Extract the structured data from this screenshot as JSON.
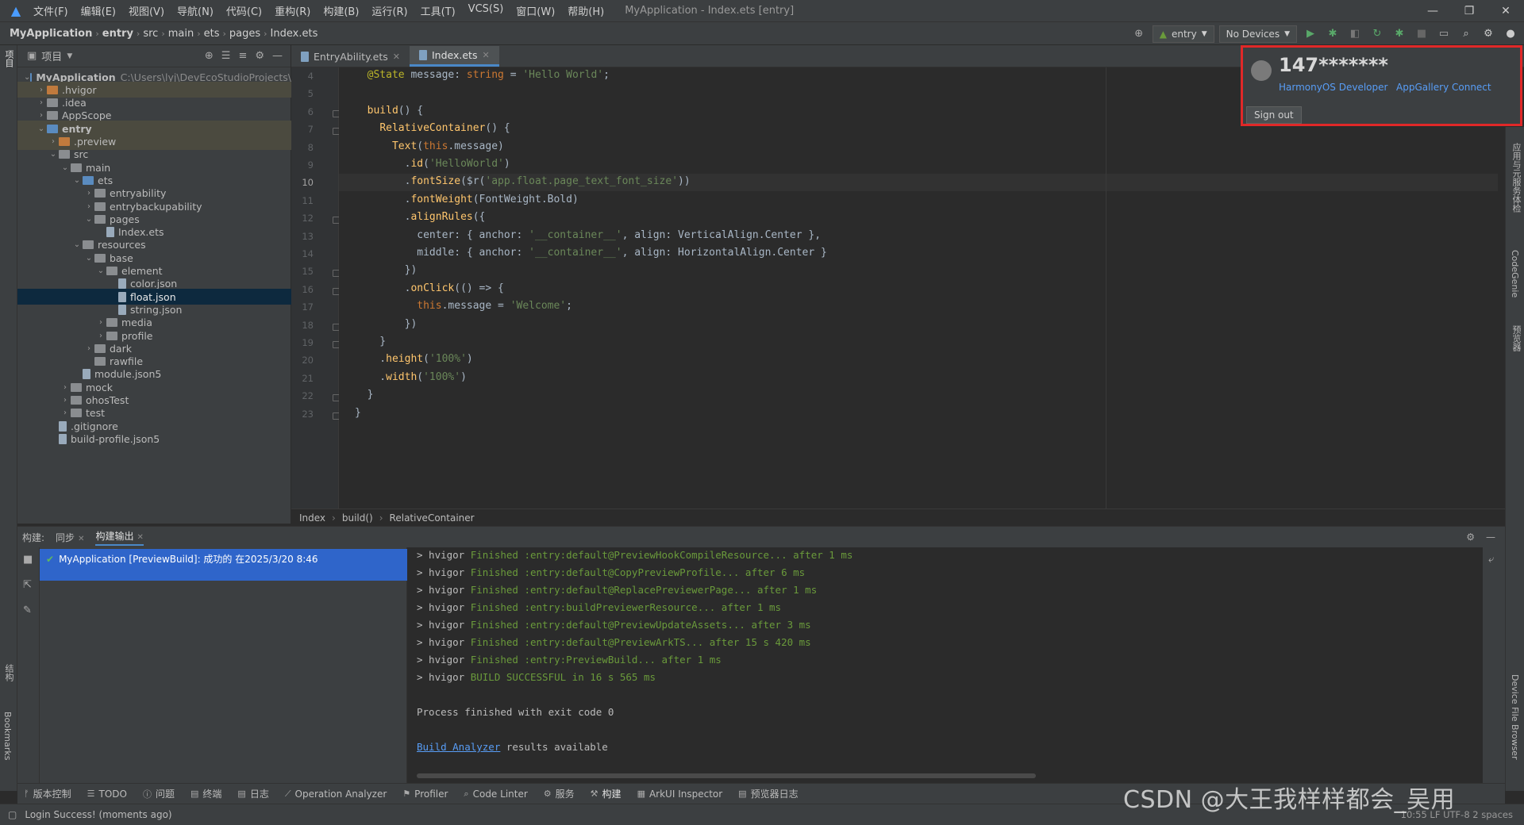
{
  "menubar": {
    "items": [
      "文件(F)",
      "编辑(E)",
      "视图(V)",
      "导航(N)",
      "代码(C)",
      "重构(R)",
      "构建(B)",
      "运行(R)",
      "工具(T)",
      "VCS(S)",
      "窗口(W)",
      "帮助(H)"
    ],
    "window_title": "MyApplication - Index.ets [entry]"
  },
  "navbar": {
    "crumbs": [
      "MyApplication",
      "entry",
      "src",
      "main",
      "ets",
      "pages",
      "Index.ets"
    ],
    "module_combo": "entry",
    "device_combo": "No Devices"
  },
  "project_panel": {
    "title": "项目",
    "tree": [
      {
        "label": "MyApplication",
        "path": "C:\\Users\\lyj\\DevEcoStudioProjects\\",
        "depth": 0,
        "chev": "v",
        "icon": "folder-blue",
        "bold": true
      },
      {
        "label": ".hvigor",
        "depth": 1,
        "chev": ">",
        "icon": "folder-orange",
        "highlight": true
      },
      {
        "label": ".idea",
        "depth": 1,
        "chev": ">",
        "icon": "folder"
      },
      {
        "label": "AppScope",
        "depth": 1,
        "chev": ">",
        "icon": "folder"
      },
      {
        "label": "entry",
        "depth": 1,
        "chev": "v",
        "icon": "folder-blue",
        "bold": true,
        "highlight": true
      },
      {
        "label": ".preview",
        "depth": 2,
        "chev": ">",
        "icon": "folder-orange",
        "highlight": true
      },
      {
        "label": "src",
        "depth": 2,
        "chev": "v",
        "icon": "folder"
      },
      {
        "label": "main",
        "depth": 3,
        "chev": "v",
        "icon": "folder"
      },
      {
        "label": "ets",
        "depth": 4,
        "chev": "v",
        "icon": "folder-blue"
      },
      {
        "label": "entryability",
        "depth": 5,
        "chev": ">",
        "icon": "folder"
      },
      {
        "label": "entrybackupability",
        "depth": 5,
        "chev": ">",
        "icon": "folder"
      },
      {
        "label": "pages",
        "depth": 5,
        "chev": "v",
        "icon": "folder"
      },
      {
        "label": "Index.ets",
        "depth": 6,
        "chev": "",
        "icon": "file"
      },
      {
        "label": "resources",
        "depth": 4,
        "chev": "v",
        "icon": "folder"
      },
      {
        "label": "base",
        "depth": 5,
        "chev": "v",
        "icon": "folder"
      },
      {
        "label": "element",
        "depth": 6,
        "chev": "v",
        "icon": "folder"
      },
      {
        "label": "color.json",
        "depth": 7,
        "chev": "",
        "icon": "file"
      },
      {
        "label": "float.json",
        "depth": 7,
        "chev": "",
        "icon": "file",
        "selected": true
      },
      {
        "label": "string.json",
        "depth": 7,
        "chev": "",
        "icon": "file"
      },
      {
        "label": "media",
        "depth": 6,
        "chev": ">",
        "icon": "folder"
      },
      {
        "label": "profile",
        "depth": 6,
        "chev": ">",
        "icon": "folder"
      },
      {
        "label": "dark",
        "depth": 5,
        "chev": ">",
        "icon": "folder"
      },
      {
        "label": "rawfile",
        "depth": 5,
        "chev": "",
        "icon": "folder"
      },
      {
        "label": "module.json5",
        "depth": 4,
        "chev": "",
        "icon": "file"
      },
      {
        "label": "mock",
        "depth": 3,
        "chev": ">",
        "icon": "folder"
      },
      {
        "label": "ohosTest",
        "depth": 3,
        "chev": ">",
        "icon": "folder"
      },
      {
        "label": "test",
        "depth": 3,
        "chev": ">",
        "icon": "folder"
      },
      {
        "label": ".gitignore",
        "depth": 2,
        "chev": "",
        "icon": "file"
      },
      {
        "label": "build-profile.json5",
        "depth": 2,
        "chev": "",
        "icon": "file"
      }
    ]
  },
  "editor": {
    "tabs": [
      {
        "label": "EntryAbility.ets",
        "active": false
      },
      {
        "label": "Index.ets",
        "active": true
      }
    ],
    "current_line": 10,
    "line_numbers": [
      4,
      5,
      6,
      7,
      8,
      9,
      10,
      11,
      12,
      13,
      14,
      15,
      16,
      17,
      18,
      19,
      20,
      21,
      22,
      23
    ],
    "lines": [
      [
        [
          "  ",
          "pl"
        ],
        [
          "@State",
          "dec"
        ],
        [
          " message: ",
          "pl"
        ],
        [
          "string",
          "ty"
        ],
        [
          " = ",
          "pl"
        ],
        [
          "'Hello World'",
          "str"
        ],
        [
          ";",
          "pl"
        ]
      ],
      [],
      [
        [
          "  ",
          "pl"
        ],
        [
          "build",
          "fn"
        ],
        [
          "() {",
          "pl"
        ]
      ],
      [
        [
          "    ",
          "pl"
        ],
        [
          "RelativeContainer",
          "fn"
        ],
        [
          "() {",
          "pl"
        ]
      ],
      [
        [
          "      ",
          "pl"
        ],
        [
          "Text",
          "fn"
        ],
        [
          "(",
          "pl"
        ],
        [
          "this",
          "this"
        ],
        [
          ".message)",
          "pl"
        ]
      ],
      [
        [
          "        .",
          "pl"
        ],
        [
          "id",
          "fn"
        ],
        [
          "(",
          "pl"
        ],
        [
          "'HelloWorld'",
          "str"
        ],
        [
          ")",
          "pl"
        ]
      ],
      [
        [
          "        .",
          "pl"
        ],
        [
          "fontSize",
          "fn"
        ],
        [
          "($r(",
          "pl"
        ],
        [
          "'app.float.page_text_font_size'",
          "str"
        ],
        [
          "))",
          "pl"
        ]
      ],
      [
        [
          "        .",
          "pl"
        ],
        [
          "fontWeight",
          "fn"
        ],
        [
          "(FontWeight.Bold)",
          "pl"
        ]
      ],
      [
        [
          "        .",
          "pl"
        ],
        [
          "alignRules",
          "fn"
        ],
        [
          "({",
          "pl"
        ]
      ],
      [
        [
          "          center: { anchor: ",
          "pl"
        ],
        [
          "'__container__'",
          "str"
        ],
        [
          ", align: VerticalAlign.Center },",
          "pl"
        ]
      ],
      [
        [
          "          middle: { anchor: ",
          "pl"
        ],
        [
          "'__container__'",
          "str"
        ],
        [
          ", align: HorizontalAlign.Center }",
          "pl"
        ]
      ],
      [
        [
          "        })",
          "pl"
        ]
      ],
      [
        [
          "        .",
          "pl"
        ],
        [
          "onClick",
          "fn"
        ],
        [
          "(() => {",
          "pl"
        ]
      ],
      [
        [
          "          ",
          "pl"
        ],
        [
          "this",
          "this"
        ],
        [
          ".message = ",
          "pl"
        ],
        [
          "'Welcome'",
          "str"
        ],
        [
          ";",
          "pl"
        ]
      ],
      [
        [
          "        })",
          "pl"
        ]
      ],
      [
        [
          "    }",
          "pl"
        ]
      ],
      [
        [
          "    .",
          "pl"
        ],
        [
          "height",
          "fn"
        ],
        [
          "(",
          "pl"
        ],
        [
          "'100%'",
          "str"
        ],
        [
          ")",
          "pl"
        ]
      ],
      [
        [
          "    .",
          "pl"
        ],
        [
          "width",
          "fn"
        ],
        [
          "(",
          "pl"
        ],
        [
          "'100%'",
          "str"
        ],
        [
          ")",
          "pl"
        ]
      ],
      [
        [
          "  }",
          "pl"
        ]
      ],
      [
        [
          "}",
          "pl"
        ]
      ]
    ],
    "breadcrumb": [
      "Index",
      "build()",
      "RelativeContainer"
    ]
  },
  "account_popup": {
    "name": "147*******",
    "link_developer": "HarmonyOS Developer",
    "link_agc": "AppGallery Connect",
    "signout_label": "Sign out"
  },
  "build_panel": {
    "header_label": "构建:",
    "tab_sync": "同步",
    "tab_output": "构建输出",
    "tree_item": "MyApplication [PreviewBuild]: 成功的 在2025/3/20 8:46",
    "output": [
      [
        "> hvigor ",
        "Finished :entry:default@PreviewHookCompileResource... after 1 ms"
      ],
      [
        "> hvigor ",
        "Finished :entry:default@CopyPreviewProfile... after 6 ms"
      ],
      [
        "> hvigor ",
        "Finished :entry:default@ReplacePreviewerPage... after 1 ms"
      ],
      [
        "> hvigor ",
        "Finished :entry:buildPreviewerResource... after 1 ms"
      ],
      [
        "> hvigor ",
        "Finished :entry:default@PreviewUpdateAssets... after 3 ms"
      ],
      [
        "> hvigor ",
        "Finished :entry:default@PreviewArkTS... after 15 s 420 ms"
      ],
      [
        "> hvigor ",
        "Finished :entry:PreviewBuild... after 1 ms"
      ],
      [
        "> hvigor ",
        "BUILD SUCCESSFUL in 16 s 565 ms"
      ],
      [
        "",
        ""
      ],
      [
        "Process finished with exit code 0",
        ""
      ],
      [
        "",
        ""
      ]
    ],
    "analyzer_link": "Build Analyzer",
    "analyzer_suffix": " results available"
  },
  "toolwindows": [
    "版本控制",
    "TODO",
    "问题",
    "终端",
    "日志",
    "Operation Analyzer",
    "Profiler",
    "Code Linter",
    "服务",
    "构建",
    "ArkUI Inspector",
    "预览器日志"
  ],
  "left_strip": {
    "project": "项目",
    "structure": "结构",
    "bookmarks": "Bookmarks"
  },
  "right_strip": {
    "a": "应用与元服务体检",
    "b": "CodeGenie",
    "c": "预览器",
    "d": "Device File Browser"
  },
  "statusbar": {
    "message": "Login Success! (moments ago)",
    "right": "10:55   LF   UTF-8   2 spaces"
  },
  "watermark": "CSDN @大王我样样都会_吴用"
}
